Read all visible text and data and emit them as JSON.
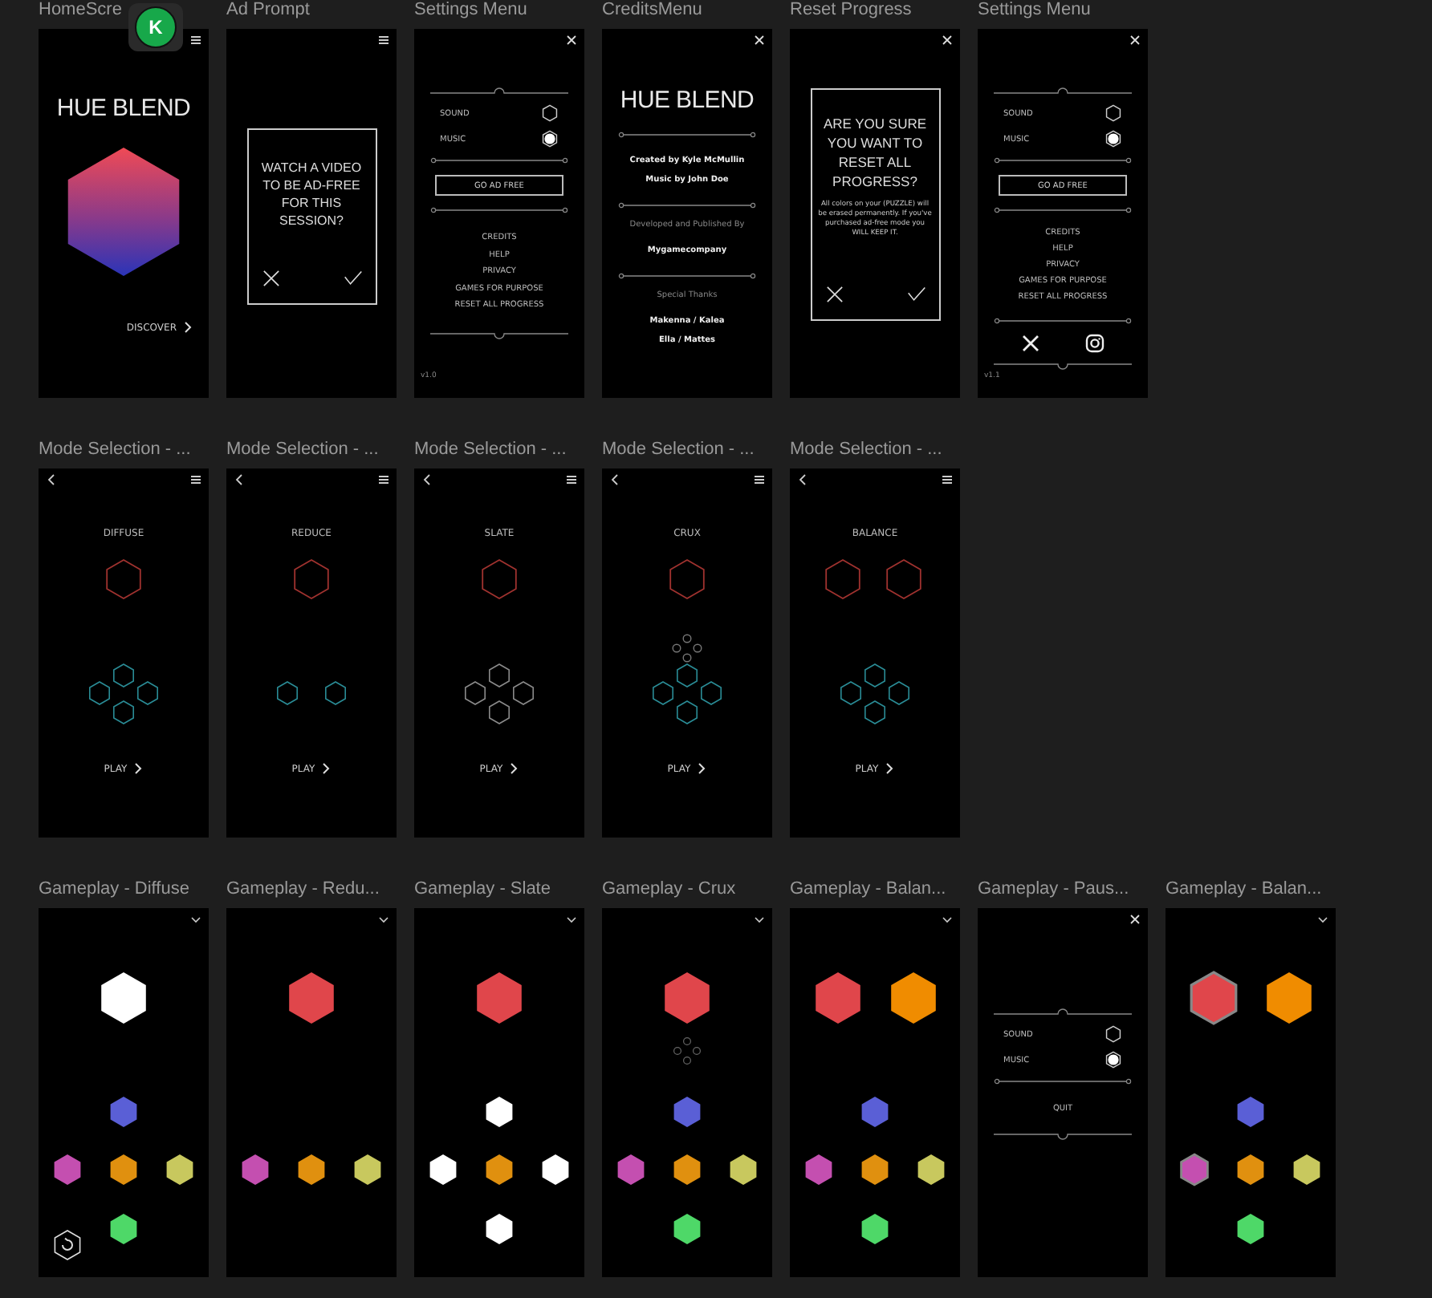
{
  "avatar": {
    "initial": "K"
  },
  "rows": [
    {
      "frames": [
        {
          "label": "HomeScre",
          "kind": "home",
          "title": "HUE BLEND",
          "link": "DISCOVER"
        },
        {
          "label": "Ad Prompt",
          "kind": "ad_prompt",
          "message": "WATCH A VIDEO TO BE AD-FREE FOR THIS SESSION?"
        },
        {
          "label": "Settings Menu",
          "kind": "settings",
          "toggles": [
            {
              "label": "SOUND",
              "on": false
            },
            {
              "label": "MUSIC",
              "on": true
            }
          ],
          "button": "GO AD FREE",
          "links": [
            "CREDITS",
            "HELP",
            "PRIVACY",
            "GAMES FOR PURPOSE",
            "RESET ALL PROGRESS"
          ],
          "version": "v1.0"
        },
        {
          "label": "CreditsMenu",
          "kind": "credits",
          "title": "HUE BLEND",
          "sections": [
            {
              "names": [
                "Created by Kyle McMullin",
                "Music by John Doe"
              ]
            },
            {
              "heading": "Developed and Published By",
              "names": [
                "Mygamecompany"
              ]
            },
            {
              "heading": "Special Thanks",
              "names": [
                "Makenna / Kalea",
                "Ella / Mattes"
              ]
            }
          ]
        },
        {
          "label": "Reset Progress",
          "kind": "reset",
          "message": "ARE YOU SURE YOU WANT TO RESET ALL PROGRESS?",
          "note": "All colors on your (PUZZLE) will be erased permanently. If you've purchased ad-free mode you WILL KEEP IT."
        },
        {
          "label": "Settings Menu",
          "kind": "settings",
          "toggles": [
            {
              "label": "SOUND",
              "on": false
            },
            {
              "label": "MUSIC",
              "on": true
            }
          ],
          "button": "GO AD FREE",
          "links": [
            "CREDITS",
            "HELP",
            "PRIVACY",
            "GAMES FOR PURPOSE",
            "RESET ALL PROGRESS"
          ],
          "social": true,
          "version": "v1.1"
        }
      ]
    },
    {
      "frames": [
        {
          "label": "Mode Selection - ...",
          "kind": "mode",
          "name": "DIFFUSE",
          "targets": [
            {
              "color": "#a0322f"
            }
          ],
          "pads": {
            "top": {
              "color": "#2a8c96"
            },
            "left": {
              "color": "#2a8c96"
            },
            "right": {
              "color": "#2a8c96"
            },
            "bottom": {
              "color": "#2a8c96"
            }
          },
          "play": "PLAY"
        },
        {
          "label": "Mode Selection - ...",
          "kind": "mode",
          "name": "REDUCE",
          "targets": [
            {
              "color": "#a0322f"
            }
          ],
          "pads": {
            "left": {
              "color": "#2a8c96"
            },
            "right": {
              "color": "#2a8c96"
            }
          },
          "play": "PLAY"
        },
        {
          "label": "Mode Selection - ...",
          "kind": "mode",
          "name": "SLATE",
          "targets": [
            {
              "color": "#a0322f"
            }
          ],
          "pads": {
            "top": {
              "color": "#8a8a8a"
            },
            "left": {
              "color": "#8a8a8a"
            },
            "right": {
              "color": "#8a8a8a"
            },
            "bottom": {
              "color": "#8a8a8a"
            }
          },
          "play": "PLAY"
        },
        {
          "label": "Mode Selection - ...",
          "kind": "mode",
          "name": "CRUX",
          "targets": [
            {
              "color": "#a0322f"
            }
          ],
          "dots": true,
          "pads": {
            "top": {
              "color": "#2a8c96"
            },
            "left": {
              "color": "#2a8c96"
            },
            "right": {
              "color": "#2a8c96"
            },
            "bottom": {
              "color": "#2a8c96"
            }
          },
          "play": "PLAY"
        },
        {
          "label": "Mode Selection - ...",
          "kind": "mode",
          "name": "BALANCE",
          "targets": [
            {
              "color": "#a0322f"
            },
            {
              "color": "#a0322f"
            }
          ],
          "pads": {
            "top": {
              "color": "#2a8c96"
            },
            "left": {
              "color": "#2a8c96"
            },
            "right": {
              "color": "#2a8c96"
            },
            "bottom": {
              "color": "#2a8c96"
            }
          },
          "play": "PLAY"
        }
      ]
    },
    {
      "frames": [
        {
          "label": "Gameplay - Diffuse",
          "kind": "game",
          "targets": [
            {
              "color": "#ffffff",
              "selected": false
            }
          ],
          "pads": {
            "top": {
              "color": "#5a5fd6",
              "selected": false
            },
            "left": {
              "color": "#c44fb0",
              "selected": false
            },
            "center": {
              "color": "#e0900f",
              "selected": false
            },
            "right": {
              "color": "#c8c85e",
              "selected": false
            },
            "bottom": {
              "color": "#4ed868",
              "selected": false
            }
          },
          "reset_button": true
        },
        {
          "label": "Gameplay - Redu...",
          "kind": "game",
          "targets": [
            {
              "color": "#e0464b",
              "selected": false
            }
          ],
          "pads": {
            "left": {
              "color": "#c44fb0",
              "selected": false
            },
            "center": {
              "color": "#e0900f",
              "selected": false
            },
            "right": {
              "color": "#c8c85e",
              "selected": false
            }
          }
        },
        {
          "label": "Gameplay - Slate",
          "kind": "game",
          "targets": [
            {
              "color": "#e0464b",
              "selected": false
            }
          ],
          "pads": {
            "top": {
              "color": "#ffffff",
              "selected": false
            },
            "left": {
              "color": "#ffffff",
              "selected": false
            },
            "center": {
              "color": "#e0900f",
              "selected": false
            },
            "right": {
              "color": "#ffffff",
              "selected": false
            },
            "bottom": {
              "color": "#ffffff",
              "selected": false
            }
          }
        },
        {
          "label": "Gameplay - Crux",
          "kind": "game",
          "targets": [
            {
              "color": "#e0464b",
              "selected": false
            }
          ],
          "dots": true,
          "pads": {
            "top": {
              "color": "#5a5fd6",
              "selected": false
            },
            "left": {
              "color": "#c44fb0",
              "selected": false
            },
            "center": {
              "color": "#e0900f",
              "selected": false
            },
            "right": {
              "color": "#c8c85e",
              "selected": false
            },
            "bottom": {
              "color": "#4ed868",
              "selected": false
            }
          }
        },
        {
          "label": "Gameplay - Balan...",
          "kind": "game",
          "targets": [
            {
              "color": "#e0464b",
              "selected": false
            },
            {
              "color": "#f08c00",
              "selected": false
            }
          ],
          "pads": {
            "top": {
              "color": "#5a5fd6",
              "selected": false
            },
            "left": {
              "color": "#c44fb0",
              "selected": false
            },
            "center": {
              "color": "#e0900f",
              "selected": false
            },
            "right": {
              "color": "#c8c85e",
              "selected": false
            },
            "bottom": {
              "color": "#4ed868",
              "selected": false
            }
          }
        },
        {
          "label": "Gameplay - Paus...",
          "kind": "pause",
          "toggles": [
            {
              "label": "SOUND",
              "on": false
            },
            {
              "label": "MUSIC",
              "on": true
            }
          ],
          "button": "QUIT"
        },
        {
          "label": "Gameplay - Balan...",
          "kind": "game",
          "targets": [
            {
              "color": "#e0464b",
              "selected": true
            },
            {
              "color": "#f08c00",
              "selected": false
            }
          ],
          "pads": {
            "top": {
              "color": "#5a5fd6",
              "selected": false
            },
            "left": {
              "color": "#c44fb0",
              "selected": true
            },
            "center": {
              "color": "#e0900f",
              "selected": false
            },
            "right": {
              "color": "#c8c85e",
              "selected": false
            },
            "bottom": {
              "color": "#4ed868",
              "selected": false
            }
          }
        }
      ]
    }
  ]
}
